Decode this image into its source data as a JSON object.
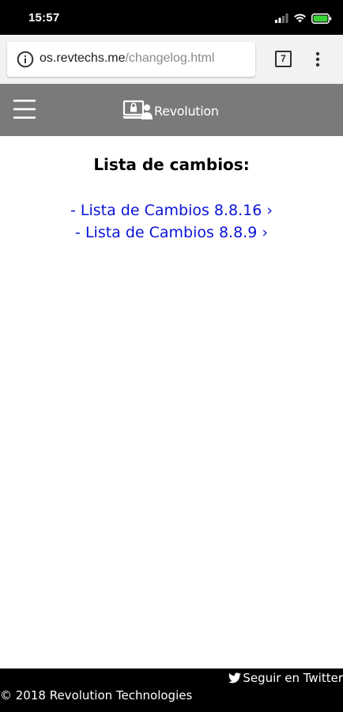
{
  "status_bar": {
    "time": "15:57",
    "icons": [
      "signal-icon",
      "wifi-icon",
      "battery-icon"
    ]
  },
  "browser": {
    "url_domain": "os.revtechs.me",
    "url_path": "/changelog.html",
    "tab_count": "7",
    "icons": [
      "info-icon",
      "tabs-icon",
      "more-menu-icon"
    ]
  },
  "header": {
    "brand": "Revolution",
    "icons": [
      "hamburger-menu-icon",
      "laptop-lock-user-icon"
    ],
    "color": "#7a7a7a"
  },
  "main": {
    "title": "Lista de cambios:",
    "items": [
      {
        "prefix": "- ",
        "label": "Lista de Cambios 8.8.16 ›"
      },
      {
        "prefix": "- ",
        "label": "Lista de Cambios 8.8.9 ›"
      }
    ],
    "link_color": "#0a14d6"
  },
  "footer": {
    "twitter": "Seguir en Twitter",
    "copyright": "© 2018 Revolution Technologies",
    "icons": [
      "twitter-bird-icon"
    ]
  }
}
